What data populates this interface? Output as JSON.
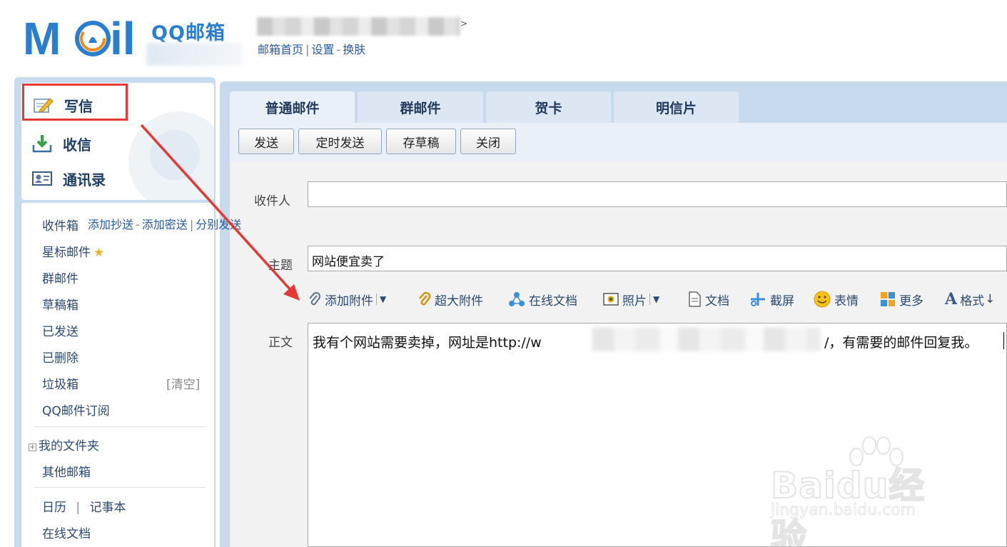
{
  "header": {
    "logo_text": "Mail",
    "brand": "QQ邮箱",
    "links": [
      "邮箱首页",
      "设置",
      "换肤"
    ],
    "link_separators": [
      "|",
      "-"
    ]
  },
  "sidebar": {
    "actions": {
      "write": "写信",
      "inbox": "收信",
      "contacts": "通讯录"
    },
    "folders": [
      "收件箱",
      "星标邮件",
      "群邮件",
      "草稿箱",
      "已发送",
      "已删除",
      "垃圾箱",
      "QQ邮件订阅"
    ],
    "clear_label": "[清空]",
    "my_folders": "我的文件夹",
    "other_mail": "其他邮箱",
    "calendar": "日历",
    "notes": "记事本",
    "calendar_sep": "|",
    "online_docs": "在线文档"
  },
  "tabs": [
    "普通邮件",
    "群邮件",
    "贺卡",
    "明信片"
  ],
  "toolbar": [
    "发送",
    "定时发送",
    "存草稿",
    "关闭"
  ],
  "compose": {
    "to_label": "收件人",
    "cc_links": [
      "添加抄送",
      "添加密送",
      "分别发送"
    ],
    "cc_seps": [
      "-",
      "|"
    ],
    "subject_label": "主题",
    "subject_value": "网站便宜卖了",
    "body_label": "正文",
    "body_part1": "我有个网站需要卖掉，网址是http://w",
    "body_part2": "/，有需要的邮件回复我。"
  },
  "attach_bar": [
    "添加附件",
    "超大附件",
    "在线文档",
    "照片",
    "文档",
    "截屏",
    "表情",
    "更多",
    "格式"
  ],
  "watermark": {
    "main": "Baidu经验",
    "sub": "jingyan.baidu.com"
  },
  "colors": {
    "accent_blue": "#2a7ed0",
    "panel_blue": "#c8daee",
    "highlight_red": "#e53935"
  }
}
